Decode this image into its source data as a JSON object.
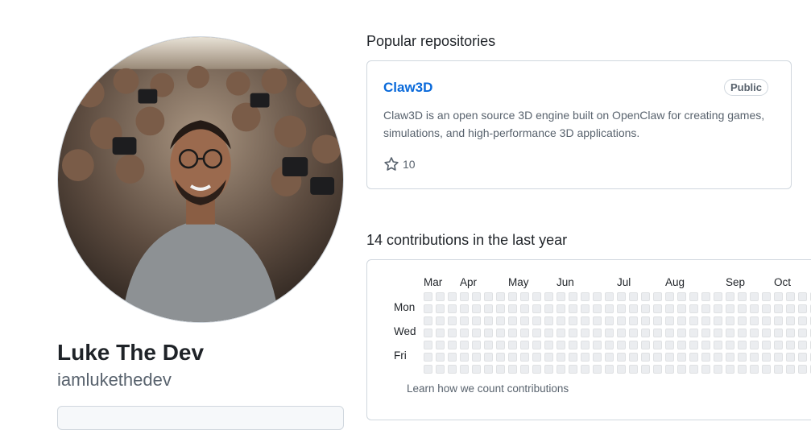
{
  "profile": {
    "name": "Luke The Dev",
    "username": "iamlukethedev"
  },
  "popular": {
    "title": "Popular repositories",
    "repos": [
      {
        "name": "Claw3D",
        "visibility": "Public",
        "description": "Claw3D is an open source 3D engine built on OpenClaw for creating games, simulations, and high-performance 3D applications.",
        "stars": "10"
      }
    ]
  },
  "contributions": {
    "title": "14 contributions in the last year",
    "months": [
      "Mar",
      "Apr",
      "May",
      "Jun",
      "Jul",
      "Aug",
      "Sep",
      "Oct"
    ],
    "day_labels": [
      "Mon",
      "Wed",
      "Fri"
    ],
    "learn_link": "Learn how we count contributions",
    "empty_cell_color": "#ebedf0"
  },
  "colors": {
    "link": "#0969da",
    "muted": "#59636e",
    "border": "#d0d7de"
  }
}
